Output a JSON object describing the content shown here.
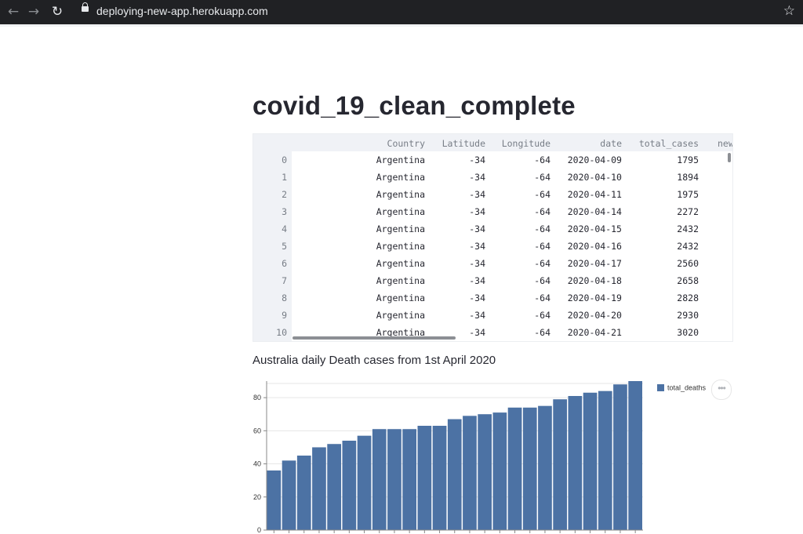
{
  "browser": {
    "url": "deploying-new-app.herokuapp.com",
    "back_icon": "←",
    "forward_icon": "→",
    "reload_icon": "↻",
    "star_icon": "☆"
  },
  "page": {
    "title": "covid_19_clean_complete",
    "caption": "Australia daily Death cases from 1st April 2020",
    "more_icon": "•••"
  },
  "table": {
    "columns": [
      "Country",
      "Latitude",
      "Longitude",
      "date",
      "total_cases",
      "new"
    ],
    "rows": [
      {
        "index": "0",
        "country": "Argentina",
        "lat": "-34",
        "lon": "-64",
        "date": "2020-04-09",
        "cases": "1795"
      },
      {
        "index": "1",
        "country": "Argentina",
        "lat": "-34",
        "lon": "-64",
        "date": "2020-04-10",
        "cases": "1894"
      },
      {
        "index": "2",
        "country": "Argentina",
        "lat": "-34",
        "lon": "-64",
        "date": "2020-04-11",
        "cases": "1975"
      },
      {
        "index": "3",
        "country": "Argentina",
        "lat": "-34",
        "lon": "-64",
        "date": "2020-04-14",
        "cases": "2272"
      },
      {
        "index": "4",
        "country": "Argentina",
        "lat": "-34",
        "lon": "-64",
        "date": "2020-04-15",
        "cases": "2432"
      },
      {
        "index": "5",
        "country": "Argentina",
        "lat": "-34",
        "lon": "-64",
        "date": "2020-04-16",
        "cases": "2432"
      },
      {
        "index": "6",
        "country": "Argentina",
        "lat": "-34",
        "lon": "-64",
        "date": "2020-04-17",
        "cases": "2560"
      },
      {
        "index": "7",
        "country": "Argentina",
        "lat": "-34",
        "lon": "-64",
        "date": "2020-04-18",
        "cases": "2658"
      },
      {
        "index": "8",
        "country": "Argentina",
        "lat": "-34",
        "lon": "-64",
        "date": "2020-04-19",
        "cases": "2828"
      },
      {
        "index": "9",
        "country": "Argentina",
        "lat": "-34",
        "lon": "-64",
        "date": "2020-04-20",
        "cases": "2930"
      },
      {
        "index": "10",
        "country": "Argentina",
        "lat": "-34",
        "lon": "-64",
        "date": "2020-04-21",
        "cases": "3020"
      }
    ]
  },
  "chart_data": {
    "type": "bar",
    "series": [
      {
        "name": "total_deaths",
        "values": [
          36,
          42,
          45,
          50,
          52,
          54,
          57,
          61,
          61,
          61,
          63,
          63,
          67,
          69,
          70,
          71,
          74,
          74,
          75,
          79,
          81,
          83,
          84,
          88,
          90
        ]
      }
    ],
    "yticks": [
      "0",
      "20",
      "40",
      "60",
      "80"
    ],
    "ylim": [
      0,
      90
    ],
    "grid": true,
    "legend": "top-right",
    "color": "#4c72a4"
  }
}
